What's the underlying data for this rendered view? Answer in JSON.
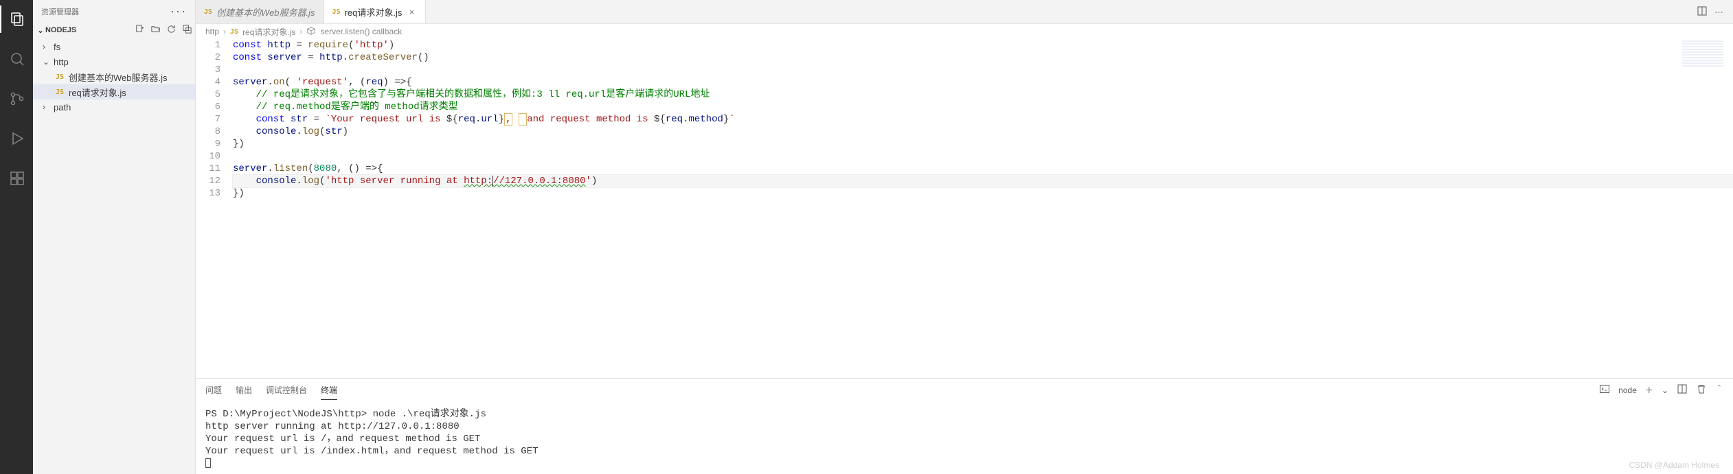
{
  "sidebar": {
    "title": "资源管理器",
    "section": "NODEJS",
    "tree": [
      {
        "type": "folder",
        "label": "fs",
        "expanded": false,
        "indent": 0
      },
      {
        "type": "folder",
        "label": "http",
        "expanded": true,
        "indent": 0
      },
      {
        "type": "file",
        "label": "创建基本的Web服务器.js",
        "indent": 1,
        "icon": "JS",
        "selected": false
      },
      {
        "type": "file",
        "label": "req请求对象.js",
        "indent": 1,
        "icon": "JS",
        "selected": true
      },
      {
        "type": "folder",
        "label": "path",
        "expanded": false,
        "indent": 0
      }
    ]
  },
  "tabs": [
    {
      "label": "创建基本的Web服务器.js",
      "active": false,
      "icon": "JS"
    },
    {
      "label": "req请求对象.js",
      "active": true,
      "icon": "JS"
    }
  ],
  "breadcrumb": {
    "parts": [
      "http",
      "req请求对象.js",
      "server.listen() callback"
    ]
  },
  "code": {
    "lines": [
      {
        "n": 1,
        "tokens": [
          [
            "kw",
            "const "
          ],
          [
            "id",
            "http"
          ],
          [
            "pun",
            " = "
          ],
          [
            "fn",
            "require"
          ],
          [
            "pun",
            "("
          ],
          [
            "str",
            "'http'"
          ],
          [
            "pun",
            ")"
          ]
        ]
      },
      {
        "n": 2,
        "tokens": [
          [
            "kw",
            "const "
          ],
          [
            "id",
            "server"
          ],
          [
            "pun",
            " = "
          ],
          [
            "id",
            "http"
          ],
          [
            "pun",
            "."
          ],
          [
            "fn",
            "createServer"
          ],
          [
            "pun",
            "()"
          ]
        ]
      },
      {
        "n": 3,
        "tokens": []
      },
      {
        "n": 4,
        "tokens": [
          [
            "id",
            "server"
          ],
          [
            "pun",
            "."
          ],
          [
            "fn",
            "on"
          ],
          [
            "pun",
            "( "
          ],
          [
            "str",
            "'request'"
          ],
          [
            "pun",
            ", ("
          ],
          [
            "id",
            "req"
          ],
          [
            "pun",
            ") =>{"
          ]
        ]
      },
      {
        "n": 5,
        "tokens": [
          [
            "pun",
            "    "
          ],
          [
            "cmt",
            "// req是请求对象，它包含了与客户端相关的数据和属性，例如:3 ll req.url是客户端请求的URL地址"
          ]
        ]
      },
      {
        "n": 6,
        "tokens": [
          [
            "pun",
            "    "
          ],
          [
            "cmt",
            "// req.method是客户端的 method请求类型"
          ]
        ]
      },
      {
        "n": 7,
        "tokens": [
          [
            "pun",
            "    "
          ],
          [
            "kw",
            "const "
          ],
          [
            "id",
            "str"
          ],
          [
            "pun",
            " = "
          ],
          [
            "str",
            "`Your request url is "
          ],
          [
            "pun",
            "${"
          ],
          [
            "id",
            "req"
          ],
          [
            "pun",
            "."
          ],
          [
            "prop",
            "url"
          ],
          [
            "pun",
            "}"
          ],
          [
            "box",
            ","
          ],
          [
            "str",
            " "
          ],
          [
            "box-end",
            ""
          ],
          [
            "str",
            "and request method is "
          ],
          [
            "pun",
            "${"
          ],
          [
            "id",
            "req"
          ],
          [
            "pun",
            "."
          ],
          [
            "prop",
            "method"
          ],
          [
            "pun",
            "}"
          ],
          [
            "str",
            "`"
          ]
        ]
      },
      {
        "n": 8,
        "tokens": [
          [
            "pun",
            "    "
          ],
          [
            "id",
            "console"
          ],
          [
            "pun",
            "."
          ],
          [
            "fn",
            "log"
          ],
          [
            "pun",
            "("
          ],
          [
            "id",
            "str"
          ],
          [
            "pun",
            ")"
          ]
        ]
      },
      {
        "n": 9,
        "tokens": [
          [
            "pun",
            "})"
          ]
        ]
      },
      {
        "n": 10,
        "tokens": []
      },
      {
        "n": 11,
        "tokens": [
          [
            "id",
            "server"
          ],
          [
            "pun",
            "."
          ],
          [
            "fn",
            "listen"
          ],
          [
            "pun",
            "("
          ],
          [
            "num",
            "8080"
          ],
          [
            "pun",
            ", () =>{"
          ]
        ]
      },
      {
        "n": 12,
        "hl": true,
        "tokens": [
          [
            "pun",
            "    "
          ],
          [
            "id",
            "console"
          ],
          [
            "pun",
            "."
          ],
          [
            "fn",
            "log"
          ],
          [
            "pun",
            "("
          ],
          [
            "str",
            "'http server running at "
          ],
          [
            "squig",
            "http:"
          ],
          [
            "cursor",
            ""
          ],
          [
            "squig",
            "//127.0.0.1:8080"
          ],
          [
            "str",
            "'"
          ],
          [
            "pun",
            ")"
          ]
        ]
      },
      {
        "n": 13,
        "tokens": [
          [
            "pun",
            "})"
          ]
        ]
      }
    ]
  },
  "panel": {
    "tabs": [
      "问题",
      "输出",
      "调试控制台",
      "终端"
    ],
    "active": 3,
    "shell_label": "node",
    "terminal_lines": [
      "PS D:\\MyProject\\NodeJS\\http> node .\\req请求对象.js",
      "http server running at http://127.0.0.1:8080",
      "Your request url is /，and request method is GET",
      "Your request url is /index.html，and request method is GET"
    ]
  },
  "watermark": "CSDN @Addam Holmes"
}
